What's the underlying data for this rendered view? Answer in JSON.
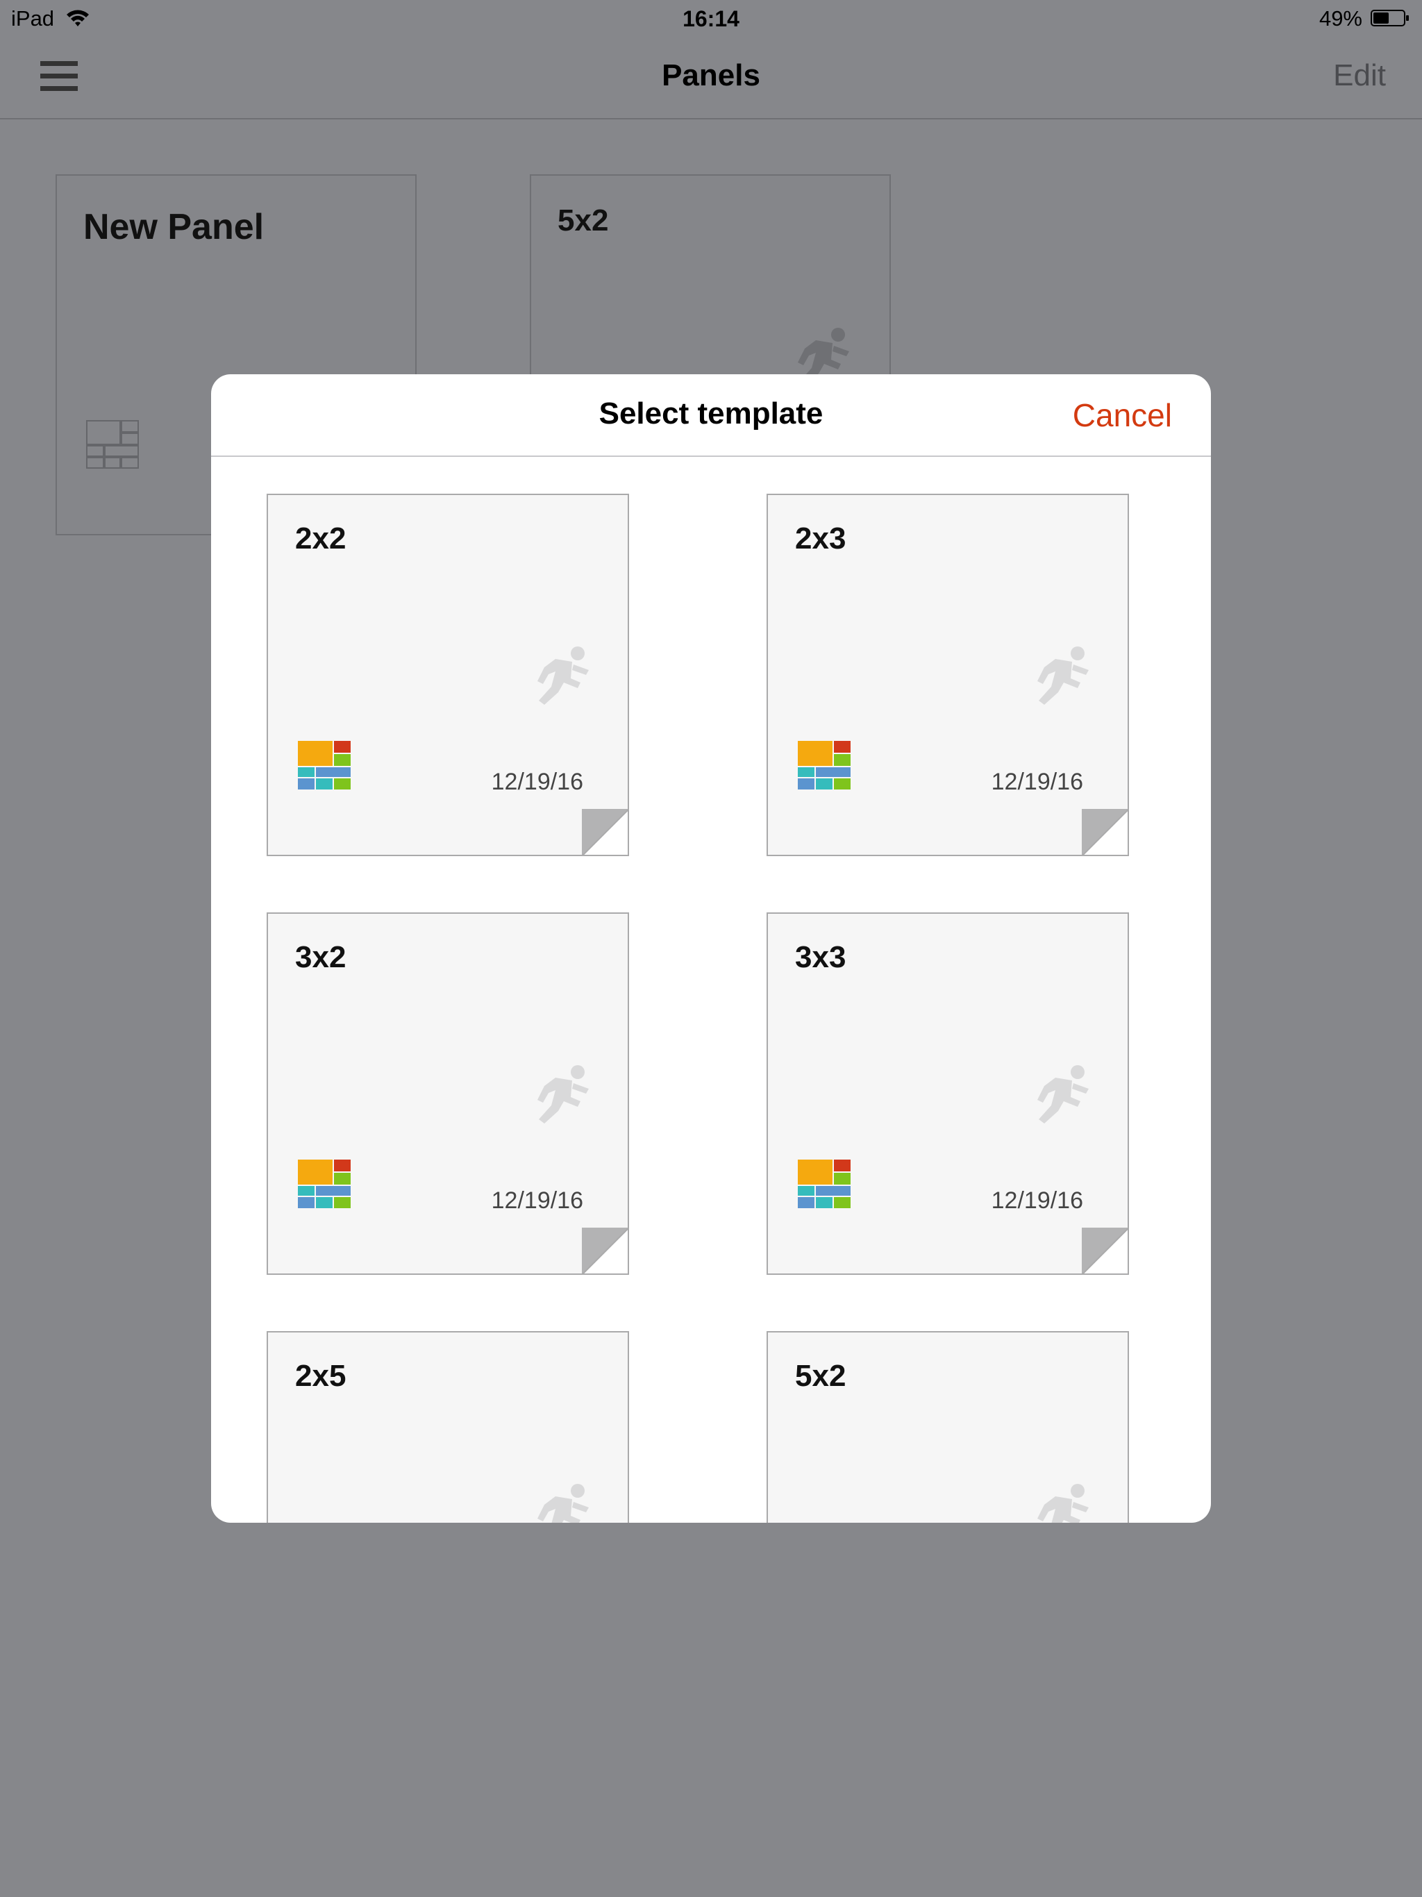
{
  "status_bar": {
    "device": "iPad",
    "time": "16:14",
    "battery": "49%"
  },
  "nav": {
    "title": "Panels",
    "edit_label": "Edit"
  },
  "background_panels": [
    {
      "title": "New Panel"
    },
    {
      "title": "5x2"
    }
  ],
  "modal": {
    "title": "Select template",
    "cancel_label": "Cancel",
    "templates": [
      {
        "title": "2x2",
        "date": "12/19/16"
      },
      {
        "title": "2x3",
        "date": "12/19/16"
      },
      {
        "title": "3x2",
        "date": "12/19/16"
      },
      {
        "title": "3x3",
        "date": "12/19/16"
      },
      {
        "title": "2x5",
        "date": ""
      },
      {
        "title": "5x2",
        "date": ""
      }
    ]
  },
  "colors": {
    "accent": "#d33a10",
    "overlay": "#86878b",
    "tile_orange": "#f5a90f",
    "tile_red": "#d2381a",
    "tile_green": "#7fc41c",
    "tile_blue": "#5b94cf",
    "tile_teal": "#35bcbc"
  },
  "icons": {
    "menu": "hamburger-menu-icon",
    "runner": "running-figure-icon",
    "grid": "grid-layout-icon",
    "fold": "page-fold-icon",
    "wifi": "wifi-icon",
    "battery": "battery-icon"
  }
}
